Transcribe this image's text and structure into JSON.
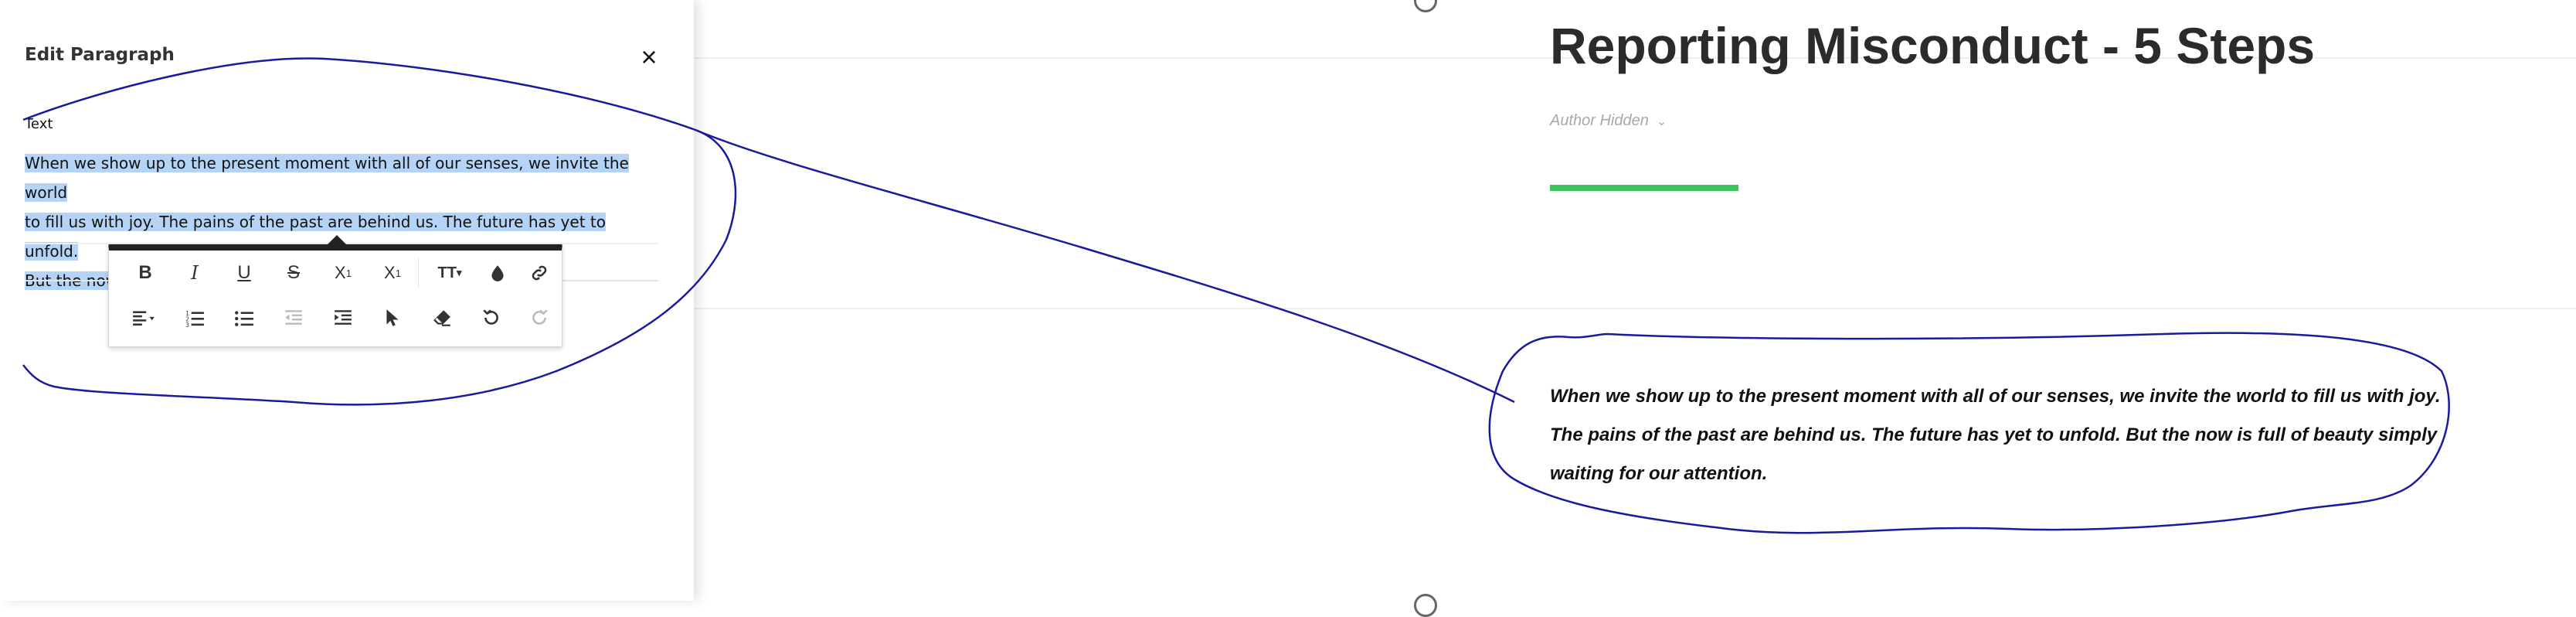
{
  "panel": {
    "title": "Edit Paragraph",
    "close_icon": "×",
    "field_label": "Text",
    "text_lines": [
      "When we show up to the present moment with all of our senses, we invite the world",
      "to fill us with joy. The pains of the past are behind us. The future has yet to unfold.",
      "But the now is full of beauty simply waiting for our attention."
    ],
    "selection_color": "#b4d3f5"
  },
  "toolbar": {
    "row1": [
      {
        "name": "bold-button",
        "glyph": "B"
      },
      {
        "name": "italic-button",
        "glyph": "I"
      },
      {
        "name": "underline-button",
        "glyph": "U"
      },
      {
        "name": "strikethrough-button",
        "glyph": "S"
      },
      {
        "name": "subscript-button",
        "glyph": "X₁"
      },
      {
        "name": "superscript-button",
        "glyph": "X¹"
      },
      {
        "name": "font-size-dropdown",
        "glyph": "TT▾"
      },
      {
        "name": "text-color-icon",
        "glyph": "drop"
      },
      {
        "name": "link-icon",
        "glyph": "link"
      }
    ],
    "row2": [
      {
        "name": "align-dropdown",
        "glyph": "align"
      },
      {
        "name": "ordered-list-button",
        "glyph": "ol"
      },
      {
        "name": "bullet-list-button",
        "glyph": "ul"
      },
      {
        "name": "outdent-button",
        "glyph": "outdent",
        "disabled": true
      },
      {
        "name": "indent-button",
        "glyph": "indent"
      },
      {
        "name": "cursor-icon",
        "glyph": "cursor"
      },
      {
        "name": "clear-format-icon",
        "glyph": "eraser"
      },
      {
        "name": "undo-icon",
        "glyph": "undo"
      },
      {
        "name": "redo-icon",
        "glyph": "redo",
        "disabled": true
      }
    ]
  },
  "page": {
    "heading": "Reporting Misconduct - 5 Steps",
    "author": "Author Hidden",
    "author_chevron": "⌄",
    "accent_color": "#3cc35a",
    "paragraph": "When we show up to the present moment with all of our senses, we invite the world to fill us with joy. The pains of the past are behind us. The future has yet to unfold. But the now is full of beauty simply waiting for our attention."
  },
  "annotation_color": "#1a1a9e"
}
